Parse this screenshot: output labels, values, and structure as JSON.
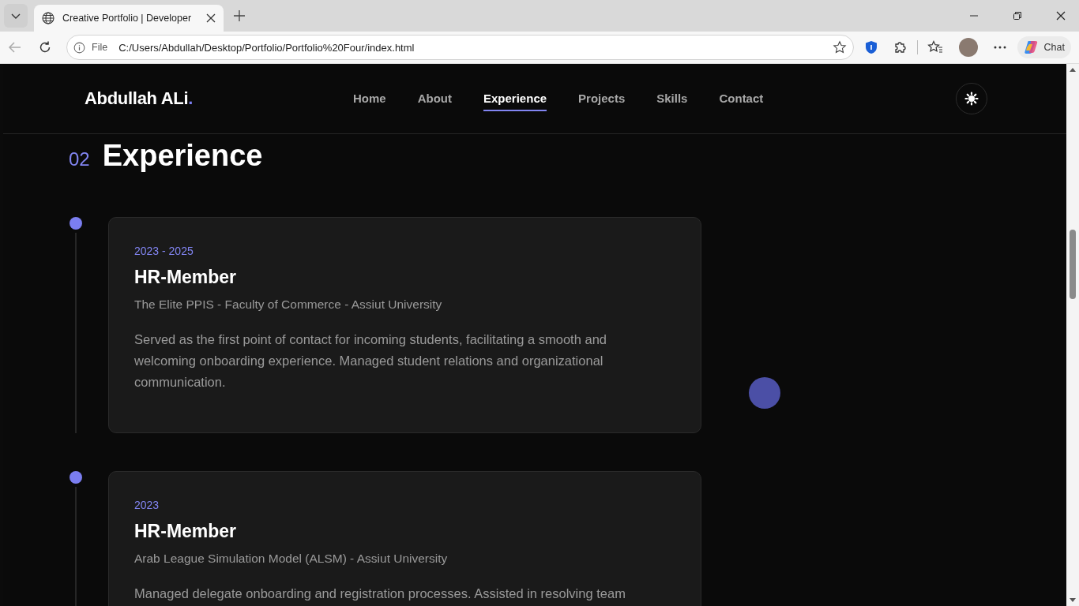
{
  "browser": {
    "tab": {
      "title": "Creative Portfolio | Developer"
    },
    "address": {
      "scheme": "File",
      "url": "C:/Users/Abdullah/Desktop/Portfolio/Portfolio%20Four/index.html"
    },
    "chat_label": "Chat"
  },
  "site": {
    "logo": "Abdullah ALi",
    "logo_dot": ".",
    "nav": [
      {
        "label": "Home",
        "selected": false
      },
      {
        "label": "About",
        "selected": false
      },
      {
        "label": "Experience",
        "selected": true
      },
      {
        "label": "Projects",
        "selected": false
      },
      {
        "label": "Skills",
        "selected": false
      },
      {
        "label": "Contact",
        "selected": false
      }
    ]
  },
  "section": {
    "number": "02",
    "title": "Experience"
  },
  "experience": [
    {
      "period": "2023 - 2025",
      "role": "HR-Member",
      "organization": "The Elite PPIS - Faculty of Commerce - Assiut University",
      "description": "Served as the first point of contact for incoming students, facilitating a smooth and welcoming onboarding experience. Managed student relations and organizational communication."
    },
    {
      "period": "2023",
      "role": "HR-Member",
      "organization": "Arab League Simulation Model (ALSM) - Assiut University",
      "description": "Managed delegate onboarding and registration processes. Assisted in resolving team"
    }
  ]
}
